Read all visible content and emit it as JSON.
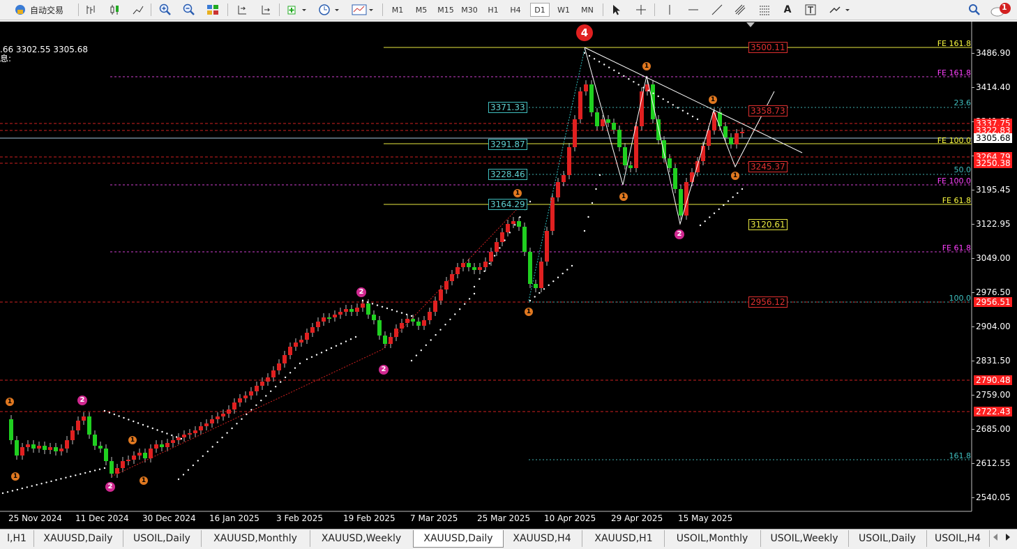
{
  "toolbar": {
    "auto_trading": "自动交易",
    "timeframes": [
      "M1",
      "M5",
      "M15",
      "M30",
      "H1",
      "H4",
      "D1",
      "W1",
      "MN"
    ],
    "active_timeframe": "D1",
    "notification_count": "1"
  },
  "info": {
    "ohlc": ".66 3302.55 3305.68",
    "label": "息:"
  },
  "chart": {
    "price_axis": [
      "3486.90",
      "3414.40",
      "3341.90",
      "3305.68",
      "3268.50",
      "3195.45",
      "3122.95",
      "3049.00",
      "2976.50",
      "2904.00",
      "2831.50",
      "2759.00",
      "2685.00",
      "2612.55",
      "2540.05"
    ],
    "date_axis": [
      "25 Nov 2024",
      "11 Dec 2024",
      "30 Dec 2024",
      "16 Jan 2025",
      "3 Feb 2025",
      "19 Feb 2025",
      "7 Mar 2025",
      "25 Mar 2025",
      "10 Apr 2025",
      "29 Apr 2025",
      "15 May 2025"
    ],
    "price_tags": [
      {
        "text": "3337.75",
        "color": "#ff2020"
      },
      {
        "text": "3322.83",
        "color": "#ff2020"
      },
      {
        "text": "3305.68",
        "color": "#ffffff"
      },
      {
        "text": "3264.79",
        "color": "#ff2020"
      },
      {
        "text": "3250.38",
        "color": "#ff2020"
      },
      {
        "text": "2956.51",
        "color": "#ff2020"
      },
      {
        "text": "2790.48",
        "color": "#ff2020"
      },
      {
        "text": "2722.43",
        "color": "#ff2020"
      }
    ],
    "level_labels": [
      "3500.11",
      "3358.73",
      "3245.37",
      "3120.61",
      "2956.12"
    ],
    "cyan_labels": [
      "3371.33",
      "3291.87",
      "3228.46",
      "3164.29"
    ],
    "fib_texts": [
      {
        "text": "FE 161.8",
        "color": "#ffff40"
      },
      {
        "text": "FE 161.8",
        "color": "#ff40ff"
      },
      {
        "text": "23.6",
        "color": "#40c0c0"
      },
      {
        "text": "FE 100.0",
        "color": "#ffff40"
      },
      {
        "text": "50.0",
        "color": "#40c0c0"
      },
      {
        "text": "FE 100.0",
        "color": "#ff40ff"
      },
      {
        "text": "FE 61.8",
        "color": "#ffff40"
      },
      {
        "text": "FE 61.8",
        "color": "#ff40ff"
      },
      {
        "text": "100.0",
        "color": "#40c0c0"
      },
      {
        "text": "161.8",
        "color": "#40c0c0"
      }
    ],
    "wave_big_label": "4",
    "wave_orange": "1",
    "wave_magenta": "2"
  },
  "tabs": [
    {
      "label": "l,H1",
      "active": false
    },
    {
      "label": "XAUUSD,Daily",
      "active": false
    },
    {
      "label": "USOIL,Daily",
      "active": false
    },
    {
      "label": "XAUUSD,Monthly",
      "active": false
    },
    {
      "label": "XAUUSD,Weekly",
      "active": false
    },
    {
      "label": "XAUUSD,Daily",
      "active": true
    },
    {
      "label": "XAUUSD,H4",
      "active": false
    },
    {
      "label": "XAUUSD,H1",
      "active": false
    },
    {
      "label": "USOIL,Monthly",
      "active": false
    },
    {
      "label": "USOIL,Weekly",
      "active": false
    },
    {
      "label": "USOIL,Daily",
      "active": false
    },
    {
      "label": "USOIL,H4",
      "active": false
    }
  ]
}
